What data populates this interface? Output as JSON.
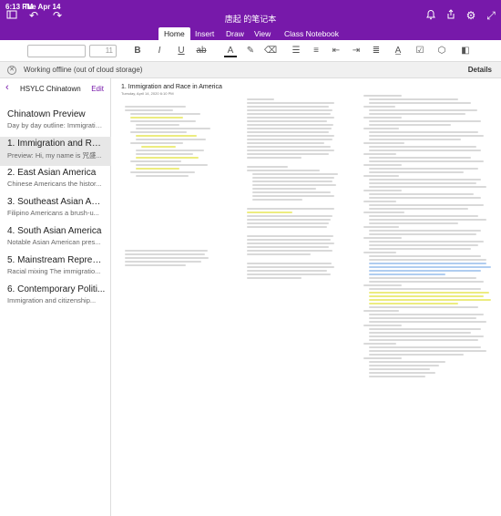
{
  "status": {
    "time": "6:13 PM",
    "date": "Tue Apr 14"
  },
  "window": {
    "title": "唐起 的笔记本"
  },
  "icons": {
    "sidebar": "sidebar-icon",
    "undo": "undo-icon",
    "redo": "redo-icon",
    "bell": "bell-icon",
    "share": "share-icon",
    "settings": "gear-icon",
    "expand": "expand-icon"
  },
  "tabs": [
    "Home",
    "Insert",
    "Draw",
    "View",
    "Class Notebook"
  ],
  "toolbar": {
    "font_size": "11"
  },
  "offline": {
    "message": "Working offline (out of cloud storage)",
    "details": "Details"
  },
  "sidebar": {
    "section_title": "HSYLC Chinatown",
    "edit": "Edit",
    "pages": [
      {
        "title": "Chinatown Preview",
        "preview": "Day by day outline:  Immigration..."
      },
      {
        "title": "1. Immigration and Rac...",
        "preview": "Preview:  Hi, my name is 咒盛..."
      },
      {
        "title": "2. East Asian America",
        "preview": "Chinese Americans  the histor..."
      },
      {
        "title": "3. Southeast Asian Am...",
        "preview": "Filipino Americans  a brush-u..."
      },
      {
        "title": "4. South Asian America",
        "preview": "Notable Asian American pres..."
      },
      {
        "title": "5. Mainstream Represe...",
        "preview": "Racial mixing  The immigratio..."
      },
      {
        "title": "6. Contemporary Politi...",
        "preview": "Immigration and citizenship..."
      }
    ]
  },
  "canvas": {
    "title": "1. Immigration and Race in America",
    "date": "Tuesday, April 14, 2020   6:10 PM"
  },
  "colors": {
    "brand": "#7719aa",
    "highlight": "#e4e44a",
    "selection": "#8fb8ea"
  }
}
